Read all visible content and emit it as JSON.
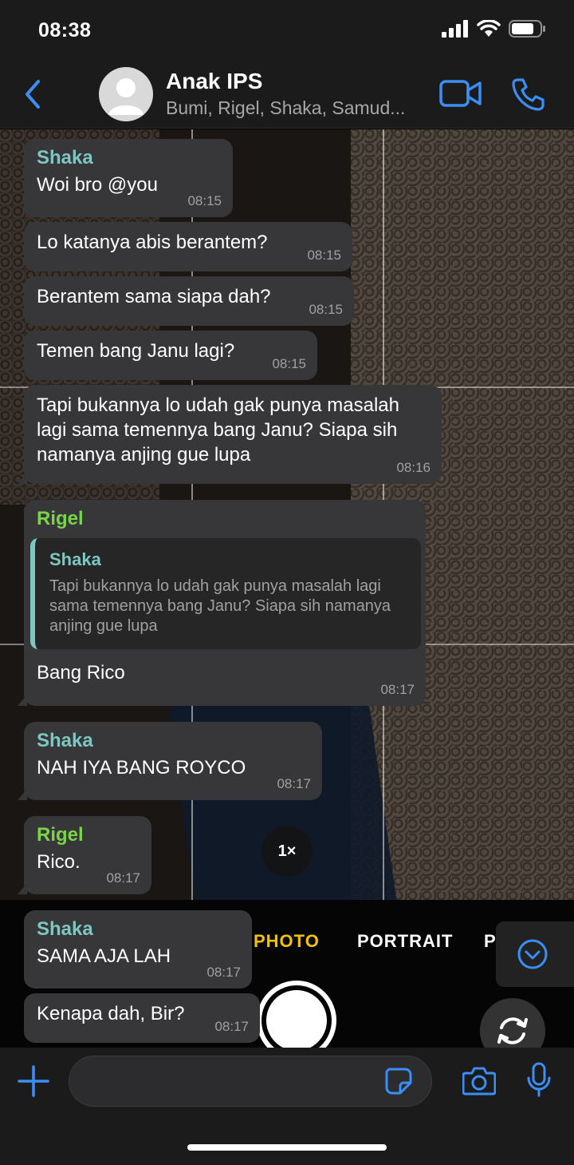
{
  "status_bar": {
    "time": "08:38"
  },
  "header": {
    "title": "Anak IPS",
    "subtitle": "Bumi, Rigel, Shaka, Samud..."
  },
  "camera_overlay": {
    "zoom": "1×",
    "modes": [
      "PHOTO",
      "PORTRAIT",
      "P"
    ]
  },
  "messages": [
    {
      "sender": "Shaka",
      "text": "Woi bro @you",
      "time": "08:15"
    },
    {
      "text": "Lo katanya abis berantem?",
      "time": "08:15"
    },
    {
      "text": "Berantem sama siapa dah?",
      "time": "08:15"
    },
    {
      "text": "Temen bang Janu lagi?",
      "time": "08:15"
    },
    {
      "text": "Tapi bukannya lo udah gak punya masalah\nlagi sama temennya bang Janu? Siapa sih\nnamanya anjing gue lupa",
      "time": "08:16"
    },
    {
      "sender": "Rigel",
      "quote": {
        "sender": "Shaka",
        "text": "Tapi bukannya lo udah gak punya masalah lagi sama temennya bang Janu? Siapa sih namanya anjing gue lupa"
      },
      "text": "Bang Rico",
      "time": "08:17"
    },
    {
      "sender": "Shaka",
      "text": "NAH IYA BANG ROYCO",
      "time": "08:17"
    },
    {
      "sender": "Rigel",
      "text": "Rico.",
      "time": "08:17"
    },
    {
      "sender": "Shaka",
      "text": "SAMA AJA LAH",
      "time": "08:17"
    },
    {
      "text": "Kenapa dah, Bir?",
      "time": "08:17"
    }
  ],
  "colors": {
    "accent": "#3a8ff7",
    "bubble": "#373739",
    "shaka": "#7fc6c0",
    "rigel": "#7bd349",
    "camera_mode_active": "#f2c200"
  }
}
